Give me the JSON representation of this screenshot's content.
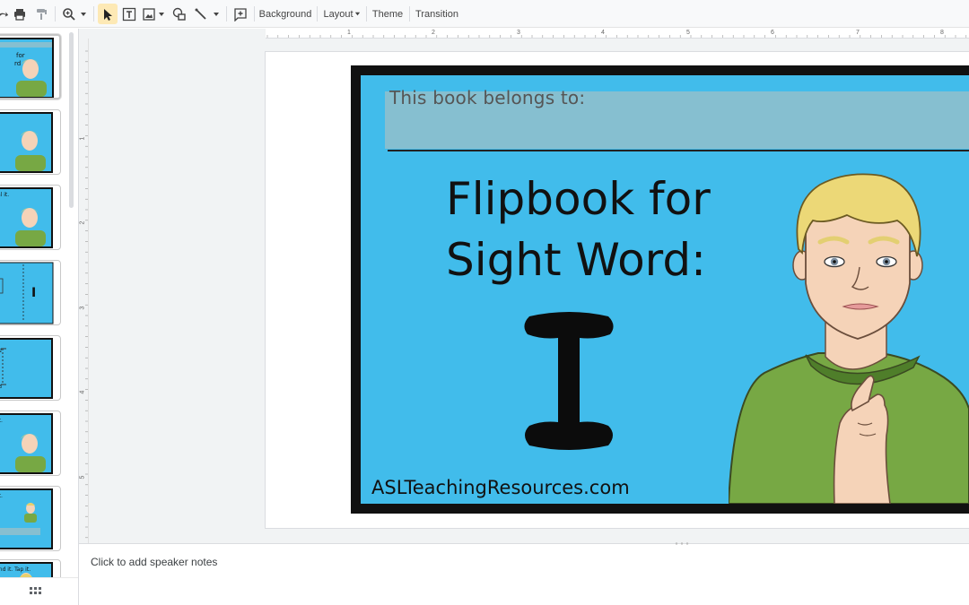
{
  "toolbar": {
    "background_label": "Background",
    "layout_label": "Layout",
    "theme_label": "Theme",
    "transition_label": "Transition"
  },
  "ruler": {
    "top_numbers": [
      "1",
      "2",
      "3",
      "4",
      "5",
      "6",
      "7",
      "8"
    ],
    "left_numbers": [
      "1",
      "2",
      "3",
      "4",
      "5"
    ]
  },
  "slide": {
    "belongs_text": "This book belongs to:",
    "title_line1": "Flipbook for",
    "title_line2": "Sight Word:",
    "big_letter": "I",
    "footer": "ASLTeachingResources.com"
  },
  "thumbnails": {
    "t1_text": "for\nrd",
    "t3_text": "al it.",
    "t6_text": "it.",
    "t7_text": "it.",
    "t8_text": "Ind it. Tap it."
  },
  "notes": {
    "placeholder": "Click to add speaker notes"
  },
  "colors": {
    "slide_blue": "#41bceb",
    "belongs_box": "#86bfd0",
    "shirt_green": "#77a844",
    "selected_tool": "#fde9b5"
  }
}
